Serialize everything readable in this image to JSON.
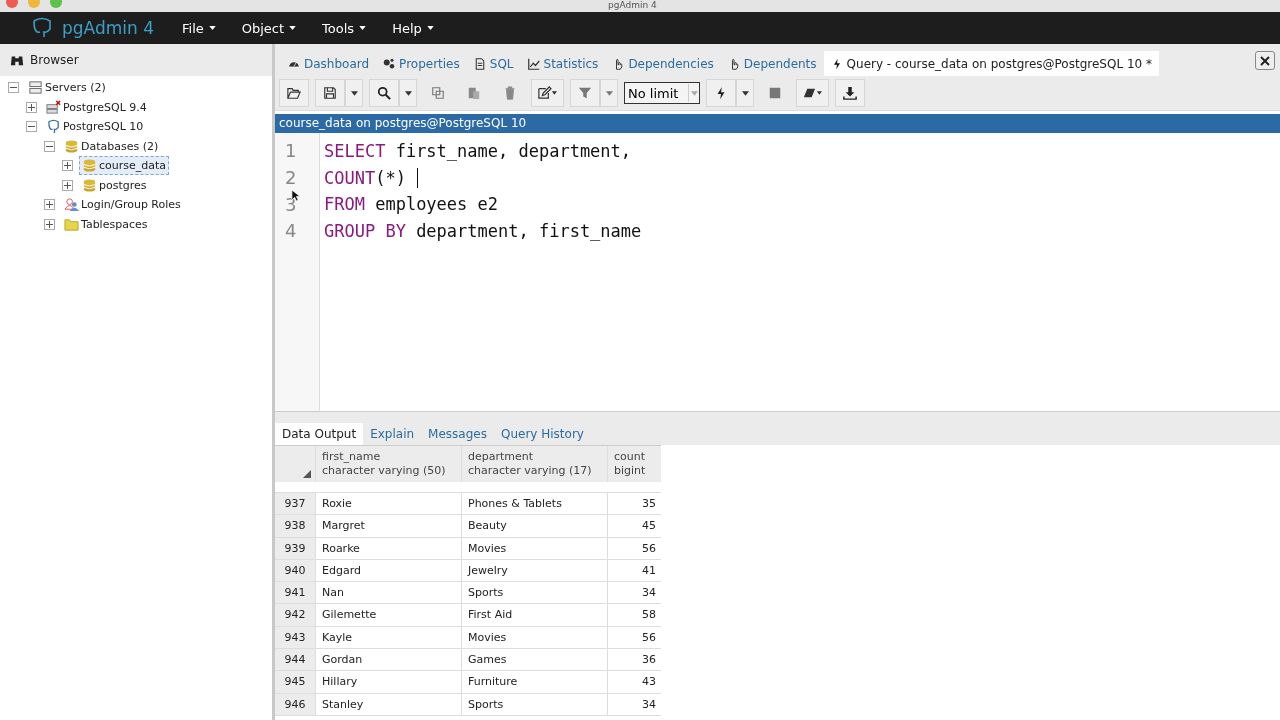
{
  "window": {
    "title": "pgAdmin 4"
  },
  "navbar": {
    "brand": "pgAdmin 4",
    "menus": [
      "File",
      "Object",
      "Tools",
      "Help"
    ]
  },
  "browser": {
    "title": "Browser",
    "tree": [
      {
        "label": "Servers (2)",
        "kind": "servers",
        "expanded": true,
        "selected": false,
        "children": [
          {
            "label": "PostgreSQL 9.4",
            "kind": "server-off",
            "expanded": false,
            "selected": false
          },
          {
            "label": "PostgreSQL 10",
            "kind": "server",
            "expanded": true,
            "selected": false,
            "children": [
              {
                "label": "Databases (2)",
                "kind": "databases",
                "expanded": true,
                "selected": false,
                "children": [
                  {
                    "label": "course_data",
                    "kind": "database",
                    "expanded": false,
                    "selected": true
                  },
                  {
                    "label": "postgres",
                    "kind": "database",
                    "expanded": false,
                    "selected": false
                  }
                ]
              },
              {
                "label": "Login/Group Roles",
                "kind": "roles",
                "expanded": false,
                "selected": false
              },
              {
                "label": "Tablespaces",
                "kind": "folder",
                "expanded": false,
                "selected": false
              }
            ]
          }
        ]
      }
    ]
  },
  "tabs": [
    {
      "label": "Dashboard",
      "kind": "gauge",
      "selected": false
    },
    {
      "label": "Properties",
      "kind": "gears",
      "selected": false
    },
    {
      "label": "SQL",
      "kind": "file",
      "selected": false
    },
    {
      "label": "Statistics",
      "kind": "chart",
      "selected": false
    },
    {
      "label": "Dependencies",
      "kind": "hand",
      "selected": false
    },
    {
      "label": "Dependents",
      "kind": "hand",
      "selected": false
    },
    {
      "label": "Query - course_data on postgres@PostgreSQL 10 *",
      "kind": "bolt",
      "selected": true
    }
  ],
  "toolbar": {
    "limit": "No limit"
  },
  "connection": "course_data on postgres@PostgreSQL 10",
  "editor": {
    "lines": [
      {
        "number": "1",
        "tokens": [
          {
            "text": "SELECT",
            "kind": "keyword"
          },
          {
            "text": " first_name, department,",
            "kind": "plain"
          }
        ]
      },
      {
        "number": "2",
        "tokens": [
          {
            "text": "COUNT",
            "kind": "keyword"
          },
          {
            "text": "(*) ",
            "kind": "plain"
          }
        ]
      },
      {
        "number": "3",
        "tokens": [
          {
            "text": "FROM",
            "kind": "keyword"
          },
          {
            "text": " employees e2",
            "kind": "plain"
          }
        ]
      },
      {
        "number": "4",
        "tokens": [
          {
            "text": "GROUP BY",
            "kind": "keyword"
          },
          {
            "text": " department, first_name",
            "kind": "plain"
          }
        ]
      }
    ]
  },
  "result_tabs": [
    {
      "label": "Data Output",
      "selected": true
    },
    {
      "label": "Explain",
      "selected": false
    },
    {
      "label": "Messages",
      "selected": false
    },
    {
      "label": "Query History",
      "selected": false
    }
  ],
  "table": {
    "columns": [
      {
        "name": "first_name",
        "type": "character varying (50)"
      },
      {
        "name": "department",
        "type": "character varying (17)"
      },
      {
        "name": "count",
        "type": "bigint"
      }
    ],
    "rows": [
      {
        "number": "937",
        "cells": [
          "Roxie",
          "Phones & Tablets",
          "35"
        ]
      },
      {
        "number": "938",
        "cells": [
          "Margret",
          "Beauty",
          "45"
        ]
      },
      {
        "number": "939",
        "cells": [
          "Roarke",
          "Movies",
          "56"
        ]
      },
      {
        "number": "940",
        "cells": [
          "Edgard",
          "Jewelry",
          "41"
        ]
      },
      {
        "number": "941",
        "cells": [
          "Nan",
          "Sports",
          "34"
        ]
      },
      {
        "number": "942",
        "cells": [
          "Gilemette",
          "First Aid",
          "58"
        ]
      },
      {
        "number": "943",
        "cells": [
          "Kayle",
          "Movies",
          "56"
        ]
      },
      {
        "number": "944",
        "cells": [
          "Gordan",
          "Games",
          "36"
        ]
      },
      {
        "number": "945",
        "cells": [
          "Hillary",
          "Furniture",
          "43"
        ]
      },
      {
        "number": "946",
        "cells": [
          "Stanley",
          "Sports",
          "34"
        ]
      }
    ]
  }
}
